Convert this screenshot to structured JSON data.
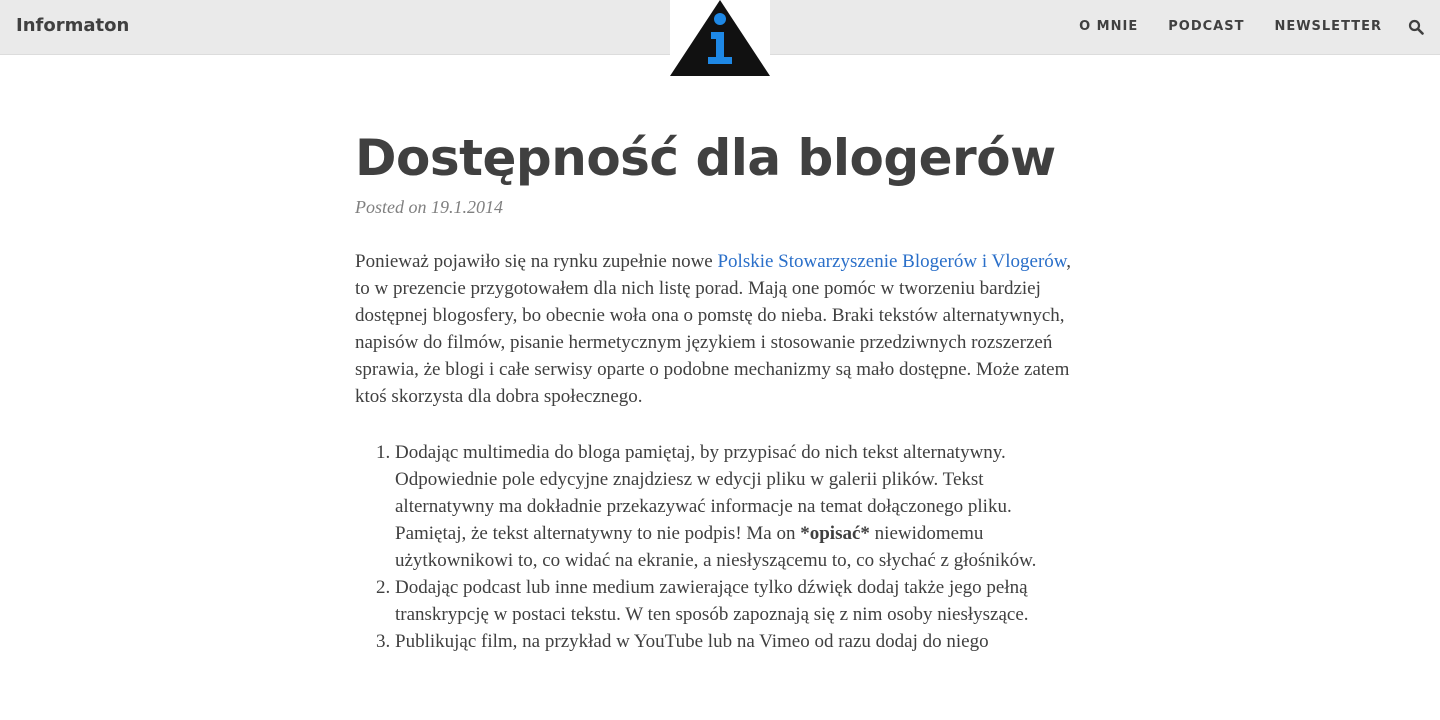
{
  "header": {
    "brand": "Informaton",
    "logo_icon": "info-triangle-logo-icon",
    "nav": [
      {
        "label": "O MNIE"
      },
      {
        "label": "PODCAST"
      },
      {
        "label": "NEWSLETTER"
      }
    ],
    "search_icon": "search-icon"
  },
  "post": {
    "title": "Dostępność dla blogerów",
    "meta": "Posted on 19.1.2014",
    "intro_before": "Ponieważ pojawiło się na rynku zupełnie nowe ",
    "intro_link": "Polskie Stowarzyszenie Blogerów i Vlogerów",
    "intro_after": ", to w prezencie przygotowałem dla nich listę porad. Mają one pomóc w tworzeniu bardziej dostępnej blogosfery, bo obecnie woła ona o pomstę do nieba. Braki tekstów alternatywnych, napisów do filmów, pisanie hermetycznym językiem i stosowanie przedziwnych rozszerzeń sprawia, że blogi i całe serwisy oparte o podobne mechanizmy są mało dostępne. Może zatem ktoś skorzysta dla dobra społecznego.",
    "tips": [
      {
        "before": "Dodając multimedia do bloga pamiętaj, by przypisać do nich tekst alternatywny. Odpowiednie pole edycyjne znajdziesz w edycji pliku w galerii plików. Tekst alternatywny ma dokładnie przekazywać informacje na temat dołączonego pliku. Pamiętaj, że tekst alternatywny to nie podpis! Ma on ",
        "strong": "*opisać*",
        "after": " niewidomemu użytkownikowi to, co widać na ekranie, a niesłyszącemu to, co słychać z głośników."
      },
      {
        "before": "Dodając podcast lub inne medium zawierające tylko dźwięk dodaj także jego pełną transkrypcję w postaci tekstu. W ten sposób zapoznają się z nim osoby niesłyszące.",
        "strong": "",
        "after": ""
      },
      {
        "before": "Publikując film, na przykład w YouTube lub na Vimeo od razu dodaj do niego",
        "strong": "",
        "after": ""
      }
    ]
  },
  "colors": {
    "navbar_bg": "#eaeaea",
    "text": "#404040",
    "link": "#2a6fc9",
    "logo_blue": "#1e88e5"
  }
}
